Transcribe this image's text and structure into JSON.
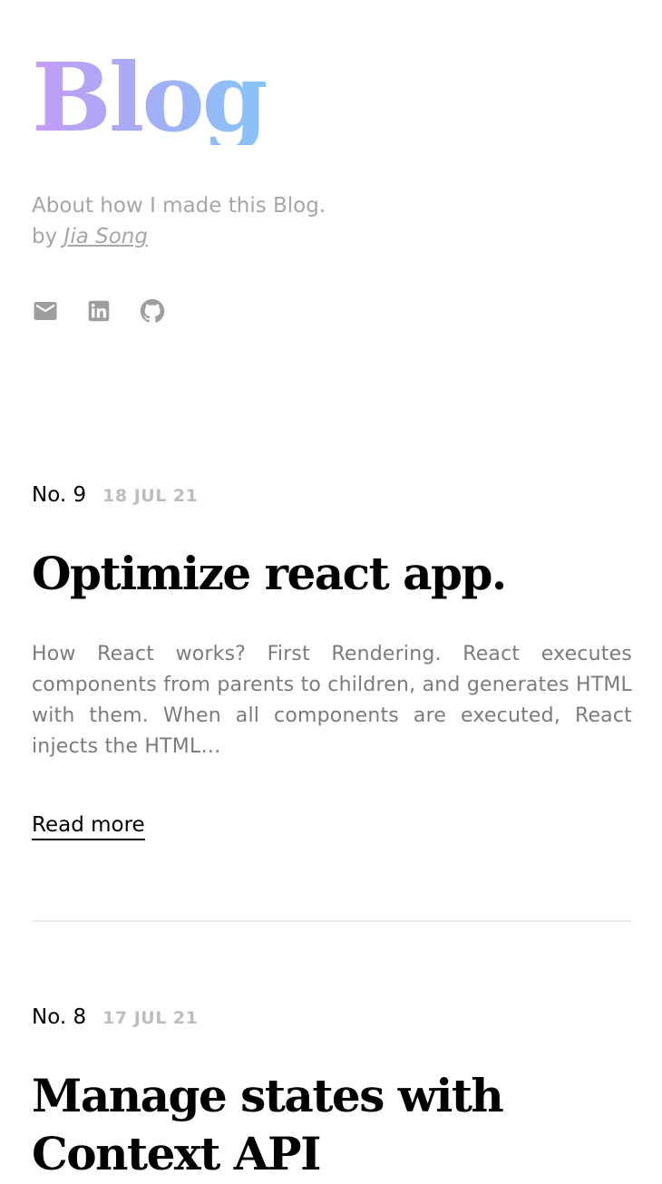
{
  "header": {
    "title": "Blog",
    "description": "About how I made this Blog.",
    "byline_prefix": "by ",
    "author": "Jia Song"
  },
  "socials": [
    {
      "name": "mail-icon"
    },
    {
      "name": "linkedin-icon"
    },
    {
      "name": "github-icon"
    }
  ],
  "posts": [
    {
      "number": "No. 9",
      "date": "18 JUL 21",
      "title": "Optimize react app.",
      "excerpt": "How React works? First Rendering. React executes components from parents to children, and generates HTML with them. When all components are executed, React injects the HTML…",
      "read_more": "Read more"
    },
    {
      "number": "No. 8",
      "date": "17 JUL 21",
      "title": "Manage states with Context API"
    }
  ]
}
